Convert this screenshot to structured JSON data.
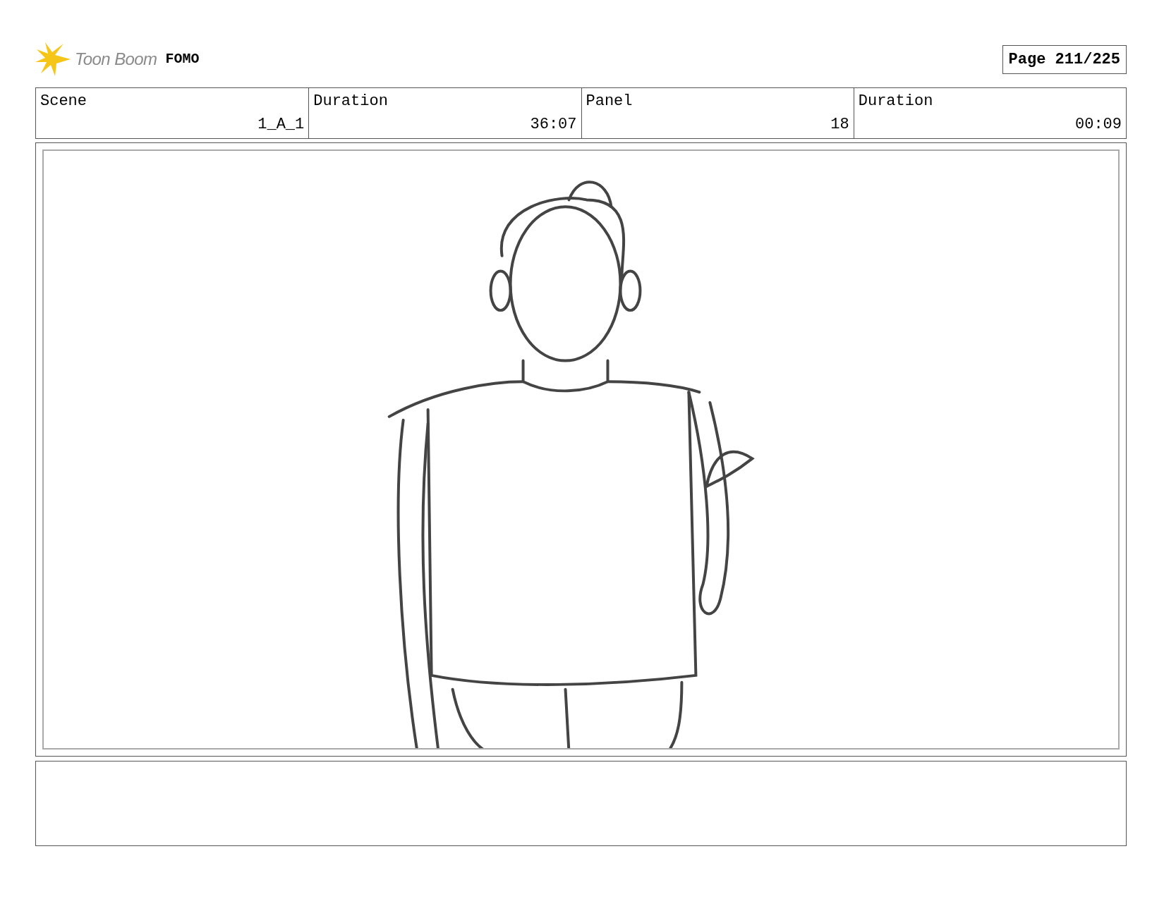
{
  "header": {
    "logo": "Toon Boom",
    "project": "FOMO",
    "page": "Page 211/225"
  },
  "info_table": {
    "columns": [
      "Scene",
      "Duration",
      "Panel",
      "Duration"
    ],
    "rows": [
      [
        "1_A_1",
        "36:07",
        "18",
        "00:09"
      ]
    ]
  }
}
